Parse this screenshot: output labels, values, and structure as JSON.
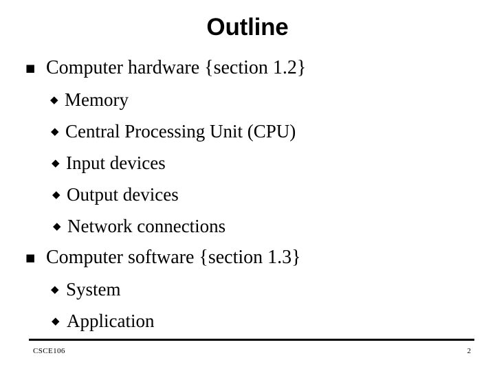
{
  "slide": {
    "title": "Outline",
    "bullet_glyphs": {
      "level1": "■",
      "level2": "◆"
    },
    "items": [
      {
        "level": 1,
        "text": "Computer hardware {section 1.2}"
      },
      {
        "level": 2,
        "text": "Memory"
      },
      {
        "level": 2,
        "text": "Central Processing Unit (CPU)"
      },
      {
        "level": 2,
        "text": "Input devices"
      },
      {
        "level": 2,
        "text": "Output devices"
      },
      {
        "level": 2,
        "text": "Network connections"
      },
      {
        "level": 1,
        "text": "Computer software {section 1.3}"
      },
      {
        "level": 2,
        "text": "System"
      },
      {
        "level": 2,
        "text": "Application"
      }
    ],
    "footer": {
      "course_code": "CSCE106",
      "page_number": "2"
    },
    "colors": {
      "background": "#ffffff",
      "text": "#000000",
      "rule": "#000000"
    }
  }
}
